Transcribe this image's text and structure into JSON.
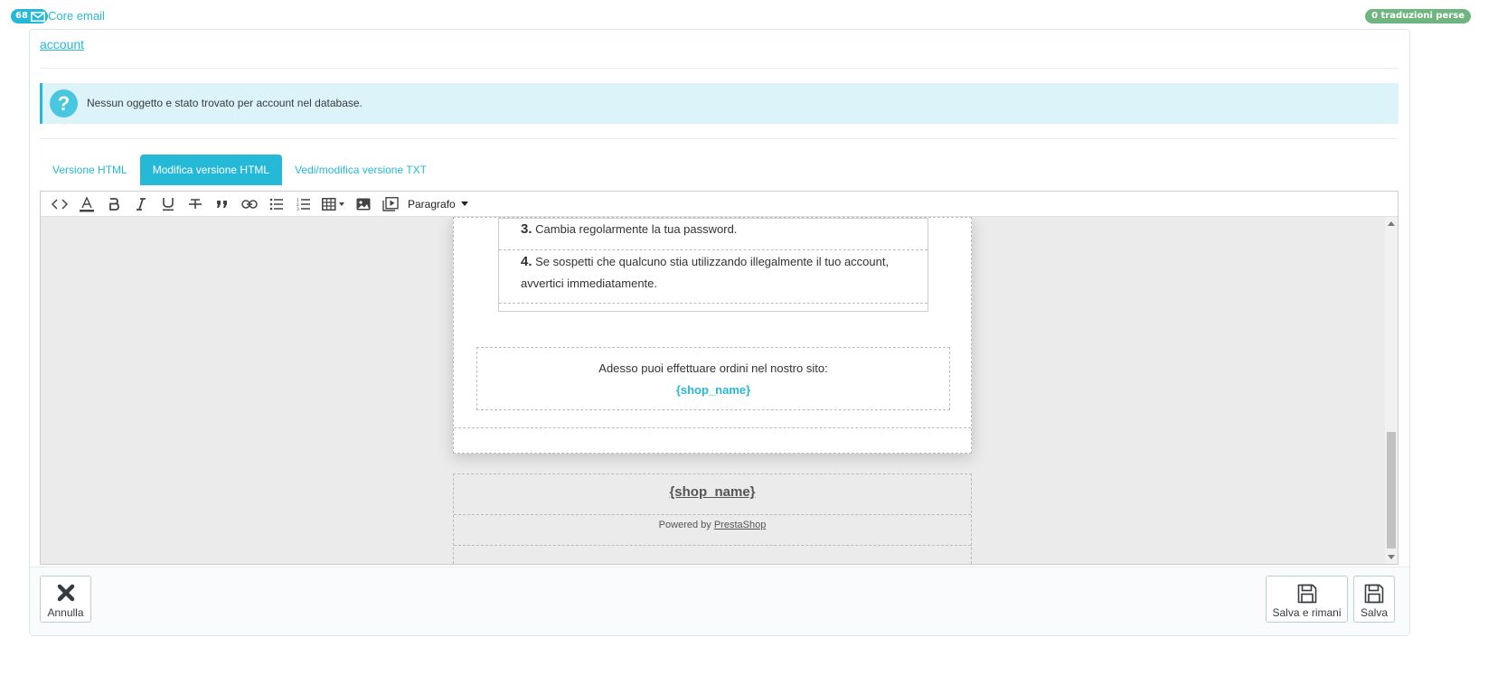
{
  "header": {
    "count": "68",
    "title": "Core email",
    "lost_translations": "0 traduzioni perse"
  },
  "email_name": "account",
  "alert": {
    "message": "Nessun oggetto e stato trovato per account nel database."
  },
  "tabs": [
    {
      "label": "Versione HTML",
      "active": false
    },
    {
      "label": "Modifica versione HTML",
      "active": true
    },
    {
      "label": "Vedi/modifica versione TXT",
      "active": false
    }
  ],
  "toolbar": {
    "format_label": "Paragrafo",
    "icons": [
      "code-icon",
      "text-color-icon",
      "bold-icon",
      "italic-icon",
      "underline-icon",
      "strikethrough-icon",
      "blockquote-icon",
      "link-icon",
      "bullet-list-icon",
      "numbered-list-icon",
      "table-icon",
      "image-icon",
      "media-icon"
    ]
  },
  "email_preview": {
    "steps": [
      {
        "num": "3.",
        "text": "Cambia regolarmente la tua password."
      },
      {
        "num": "4.",
        "text": "Se sospetti che qualcuno stia utilizzando illegalmente il tuo account, avvertici immediatamente."
      }
    ],
    "order_text": "Adesso puoi effettuare ordini nel nostro sito:",
    "shop_name": "{shop_name}",
    "footer_shop_name": "{shop_name}",
    "powered_by": "Powered by",
    "powered_brand": "PrestaShop"
  },
  "actions": {
    "cancel_label": "Annulla",
    "save_stay_label": "Salva e rimani",
    "save_label": "Salva"
  },
  "colors": {
    "accent": "#25b9d7",
    "success": "#70b580",
    "info_bg": "#dcf4f9"
  }
}
